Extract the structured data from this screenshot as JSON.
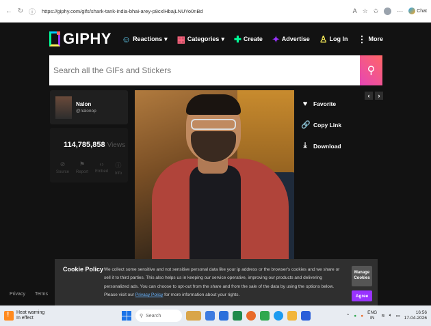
{
  "browser": {
    "url": "https://giphy.com/gifs/shark-tank-india-bhai-arey-p8cxlHbajLNUYo0nBd",
    "copilot_label": "Chat"
  },
  "header": {
    "logo": "GIPHY",
    "nav": [
      {
        "label": "Reactions",
        "icon": "smile-icon",
        "glyph": "☺",
        "caret": "▾"
      },
      {
        "label": "Categories",
        "icon": "grid-icon",
        "glyph": "▦",
        "caret": "▾"
      },
      {
        "label": "Create",
        "icon": "plus-icon",
        "glyph": "✚",
        "caret": ""
      },
      {
        "label": "Advertise",
        "icon": "megaphone-icon",
        "glyph": "✦",
        "caret": ""
      },
      {
        "label": "Log In",
        "icon": "user-icon",
        "glyph": "♙",
        "caret": ""
      },
      {
        "label": "More",
        "icon": "more-icon",
        "glyph": "⋮",
        "caret": ""
      }
    ]
  },
  "search": {
    "placeholder": "Search all the GIFs and Stickers"
  },
  "user": {
    "name": "Nalon",
    "handle": "@nalonop"
  },
  "stats": {
    "views_count": "114,785,858",
    "views_label": "Views",
    "icons": [
      {
        "label": "Source",
        "glyph": "⊘",
        "icon": "source-icon"
      },
      {
        "label": "Report",
        "glyph": "⚑",
        "icon": "flag-icon"
      },
      {
        "label": "Embed",
        "glyph": "‹›",
        "icon": "embed-icon"
      },
      {
        "label": "Info",
        "glyph": "ⓘ",
        "icon": "info-icon"
      }
    ]
  },
  "actions": [
    {
      "label": "Favorite",
      "glyph": "♥",
      "icon": "heart-icon"
    },
    {
      "label": "Copy Link",
      "glyph": "🔗",
      "icon": "link-icon"
    },
    {
      "label": "Download",
      "glyph": "⤓",
      "icon": "download-icon"
    }
  ],
  "pager": {
    "prev": "‹",
    "next": "›"
  },
  "footer": {
    "privacy": "Privacy",
    "terms": "Terms"
  },
  "cookie": {
    "title": "Cookie Policy",
    "text": "We collect some sensitive and not sensitive personal data like your ip address or the browser's cookies and we share or sell it to third parties. This also helps us in keeping our service operative, improving our products and delivering personalized ads. You can choose to opt-out from the share and from the sale of the data by using the options below. Please visit our ",
    "link": "Privacy Policy",
    "text_after": " for more information about your rights.",
    "manage": "Manage Cookies",
    "agree": "Agree"
  },
  "taskbar": {
    "weather_title": "Heat warning",
    "weather_sub": "In effect",
    "search_label": "Search",
    "lang": "ENG",
    "lang_sub": "IN",
    "time": "16:56",
    "date": "17-04-2026"
  }
}
